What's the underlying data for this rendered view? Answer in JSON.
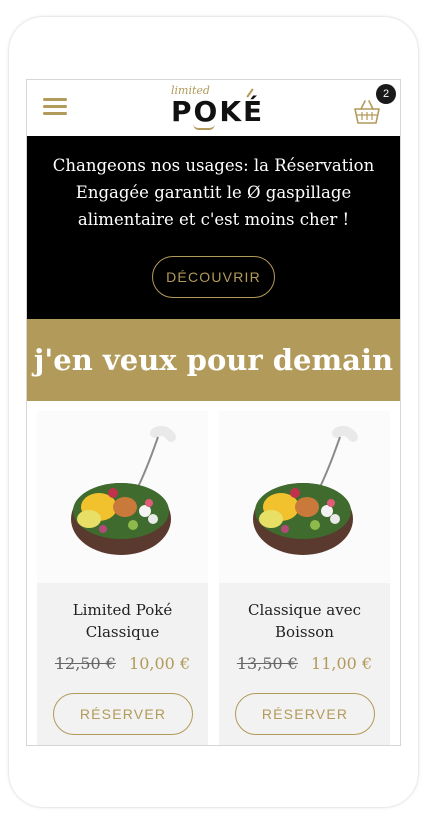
{
  "header": {
    "logo_small": "limited",
    "logo_main": "POKÉ",
    "cart_count": "2"
  },
  "banner": {
    "text": "Changeons nos usages: la Réservation Engagée garantit le Ø gaspillage alimentaire et c'est moins cher !",
    "button_label": "DÉCOUVRIR"
  },
  "section": {
    "title": "j'en veux pour demain"
  },
  "products": [
    {
      "name": "Limited Poké Classique",
      "price_old": "12,50 €",
      "price_new": "10,00 €",
      "button_label": "RÉSERVER"
    },
    {
      "name": "Classique avec Boisson",
      "price_old": "13,50 €",
      "price_new": "11,00 €",
      "button_label": "RÉSERVER"
    }
  ],
  "colors": {
    "accent": "#b29a5a",
    "banner_bg": "#000000",
    "card_bg": "#f2f2f2"
  },
  "icons": {
    "menu": "hamburger-menu-icon",
    "cart": "shopping-basket-icon"
  }
}
